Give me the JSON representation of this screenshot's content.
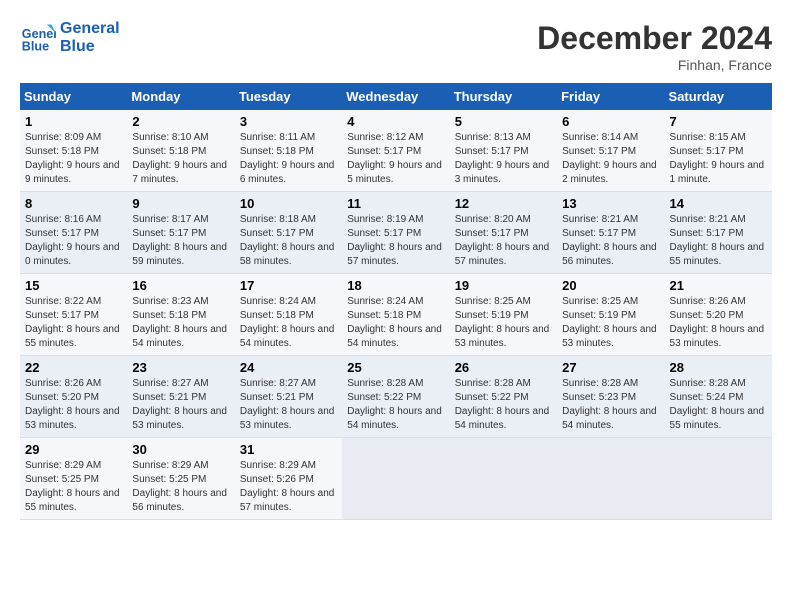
{
  "header": {
    "logo_line1": "General",
    "logo_line2": "Blue",
    "month": "December 2024",
    "location": "Finhan, France"
  },
  "weekdays": [
    "Sunday",
    "Monday",
    "Tuesday",
    "Wednesday",
    "Thursday",
    "Friday",
    "Saturday"
  ],
  "weeks": [
    [
      {
        "day": "1",
        "sunrise": "8:09 AM",
        "sunset": "5:18 PM",
        "daylight": "9 hours and 9 minutes."
      },
      {
        "day": "2",
        "sunrise": "8:10 AM",
        "sunset": "5:18 PM",
        "daylight": "9 hours and 7 minutes."
      },
      {
        "day": "3",
        "sunrise": "8:11 AM",
        "sunset": "5:18 PM",
        "daylight": "9 hours and 6 minutes."
      },
      {
        "day": "4",
        "sunrise": "8:12 AM",
        "sunset": "5:17 PM",
        "daylight": "9 hours and 5 minutes."
      },
      {
        "day": "5",
        "sunrise": "8:13 AM",
        "sunset": "5:17 PM",
        "daylight": "9 hours and 3 minutes."
      },
      {
        "day": "6",
        "sunrise": "8:14 AM",
        "sunset": "5:17 PM",
        "daylight": "9 hours and 2 minutes."
      },
      {
        "day": "7",
        "sunrise": "8:15 AM",
        "sunset": "5:17 PM",
        "daylight": "9 hours and 1 minute."
      }
    ],
    [
      {
        "day": "8",
        "sunrise": "8:16 AM",
        "sunset": "5:17 PM",
        "daylight": "9 hours and 0 minutes."
      },
      {
        "day": "9",
        "sunrise": "8:17 AM",
        "sunset": "5:17 PM",
        "daylight": "8 hours and 59 minutes."
      },
      {
        "day": "10",
        "sunrise": "8:18 AM",
        "sunset": "5:17 PM",
        "daylight": "8 hours and 58 minutes."
      },
      {
        "day": "11",
        "sunrise": "8:19 AM",
        "sunset": "5:17 PM",
        "daylight": "8 hours and 57 minutes."
      },
      {
        "day": "12",
        "sunrise": "8:20 AM",
        "sunset": "5:17 PM",
        "daylight": "8 hours and 57 minutes."
      },
      {
        "day": "13",
        "sunrise": "8:21 AM",
        "sunset": "5:17 PM",
        "daylight": "8 hours and 56 minutes."
      },
      {
        "day": "14",
        "sunrise": "8:21 AM",
        "sunset": "5:17 PM",
        "daylight": "8 hours and 55 minutes."
      }
    ],
    [
      {
        "day": "15",
        "sunrise": "8:22 AM",
        "sunset": "5:17 PM",
        "daylight": "8 hours and 55 minutes."
      },
      {
        "day": "16",
        "sunrise": "8:23 AM",
        "sunset": "5:18 PM",
        "daylight": "8 hours and 54 minutes."
      },
      {
        "day": "17",
        "sunrise": "8:24 AM",
        "sunset": "5:18 PM",
        "daylight": "8 hours and 54 minutes."
      },
      {
        "day": "18",
        "sunrise": "8:24 AM",
        "sunset": "5:18 PM",
        "daylight": "8 hours and 54 minutes."
      },
      {
        "day": "19",
        "sunrise": "8:25 AM",
        "sunset": "5:19 PM",
        "daylight": "8 hours and 53 minutes."
      },
      {
        "day": "20",
        "sunrise": "8:25 AM",
        "sunset": "5:19 PM",
        "daylight": "8 hours and 53 minutes."
      },
      {
        "day": "21",
        "sunrise": "8:26 AM",
        "sunset": "5:20 PM",
        "daylight": "8 hours and 53 minutes."
      }
    ],
    [
      {
        "day": "22",
        "sunrise": "8:26 AM",
        "sunset": "5:20 PM",
        "daylight": "8 hours and 53 minutes."
      },
      {
        "day": "23",
        "sunrise": "8:27 AM",
        "sunset": "5:21 PM",
        "daylight": "8 hours and 53 minutes."
      },
      {
        "day": "24",
        "sunrise": "8:27 AM",
        "sunset": "5:21 PM",
        "daylight": "8 hours and 53 minutes."
      },
      {
        "day": "25",
        "sunrise": "8:28 AM",
        "sunset": "5:22 PM",
        "daylight": "8 hours and 54 minutes."
      },
      {
        "day": "26",
        "sunrise": "8:28 AM",
        "sunset": "5:22 PM",
        "daylight": "8 hours and 54 minutes."
      },
      {
        "day": "27",
        "sunrise": "8:28 AM",
        "sunset": "5:23 PM",
        "daylight": "8 hours and 54 minutes."
      },
      {
        "day": "28",
        "sunrise": "8:28 AM",
        "sunset": "5:24 PM",
        "daylight": "8 hours and 55 minutes."
      }
    ],
    [
      {
        "day": "29",
        "sunrise": "8:29 AM",
        "sunset": "5:25 PM",
        "daylight": "8 hours and 55 minutes."
      },
      {
        "day": "30",
        "sunrise": "8:29 AM",
        "sunset": "5:25 PM",
        "daylight": "8 hours and 56 minutes."
      },
      {
        "day": "31",
        "sunrise": "8:29 AM",
        "sunset": "5:26 PM",
        "daylight": "8 hours and 57 minutes."
      },
      null,
      null,
      null,
      null
    ]
  ]
}
